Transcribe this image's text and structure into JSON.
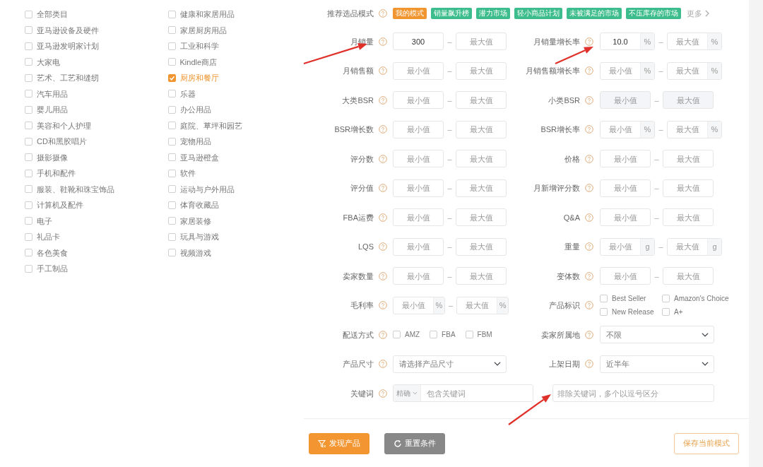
{
  "category_columns": [
    {
      "items": [
        {
          "label": "全部类目",
          "checked": false
        },
        {
          "label": "亚马逊设备及硬件",
          "checked": false
        },
        {
          "label": "亚马逊发明家计划",
          "checked": false
        },
        {
          "label": "大家电",
          "checked": false
        },
        {
          "label": "艺术、工艺和缝纫",
          "checked": false
        },
        {
          "label": "汽车用品",
          "checked": false
        },
        {
          "label": "婴儿用品",
          "checked": false
        },
        {
          "label": "美容和个人护理",
          "checked": false
        },
        {
          "label": "CD和黑胶唱片",
          "checked": false
        },
        {
          "label": "摄影摄像",
          "checked": false
        },
        {
          "label": "手机和配件",
          "checked": false
        },
        {
          "label": "服装、鞋靴和珠宝饰品",
          "checked": false
        },
        {
          "label": "计算机及配件",
          "checked": false
        },
        {
          "label": "电子",
          "checked": false
        },
        {
          "label": "礼品卡",
          "checked": false
        },
        {
          "label": "各色美食",
          "checked": false
        },
        {
          "label": "手工制品",
          "checked": false
        }
      ]
    },
    {
      "items": [
        {
          "label": "健康和家居用品",
          "checked": false
        },
        {
          "label": "家居厨房用品",
          "checked": false
        },
        {
          "label": "工业和科学",
          "checked": false
        },
        {
          "label": "Kindle商店",
          "checked": false
        },
        {
          "label": "厨房和餐厅",
          "checked": true
        },
        {
          "label": "乐器",
          "checked": false
        },
        {
          "label": "办公用品",
          "checked": false
        },
        {
          "label": "庭院、草坪和园艺",
          "checked": false
        },
        {
          "label": "宠物用品",
          "checked": false
        },
        {
          "label": "亚马逊橙盒",
          "checked": false
        },
        {
          "label": "软件",
          "checked": false
        },
        {
          "label": "运动与户外用品",
          "checked": false
        },
        {
          "label": "体育收藏品",
          "checked": false
        },
        {
          "label": "家居装修",
          "checked": false
        },
        {
          "label": "玩具与游戏",
          "checked": false
        },
        {
          "label": "视频游戏",
          "checked": false
        }
      ]
    }
  ],
  "mode": {
    "label": "推荐选品模式",
    "tags": [
      {
        "label": "我的模式",
        "selected": true
      },
      {
        "label": "销量飙升榜",
        "selected": false
      },
      {
        "label": "潜力市场",
        "selected": false
      },
      {
        "label": "轻小商品计划",
        "selected": false
      },
      {
        "label": "未被满足的市场",
        "selected": false
      },
      {
        "label": "不压库存的市场",
        "selected": false
      }
    ],
    "more": "更多"
  },
  "filter_rows": [
    [
      {
        "label": "月销量",
        "kind": "range",
        "disabled": false,
        "min": {
          "value": "300"
        },
        "separator": "–",
        "max": {
          "placeholder": "最大值"
        }
      },
      {
        "label": "月销量增长率",
        "kind": "range",
        "disabled": false,
        "min": {
          "value": "10.0",
          "unit": "%"
        },
        "separator": "–",
        "max": {
          "placeholder": "最大值",
          "unit": "%"
        }
      }
    ],
    [
      {
        "label": "月销售额",
        "kind": "range",
        "disabled": false,
        "min": {
          "placeholder": "最小值"
        },
        "separator": "–",
        "max": {
          "placeholder": "最大值"
        }
      },
      {
        "label": "月销售额增长率",
        "kind": "range",
        "disabled": false,
        "min": {
          "placeholder": "最小值",
          "unit": "%"
        },
        "separator": "–",
        "max": {
          "placeholder": "最大值",
          "unit": "%"
        }
      }
    ],
    [
      {
        "label": "大类BSR",
        "kind": "range",
        "disabled": false,
        "min": {
          "placeholder": "最小值"
        },
        "separator": "–",
        "max": {
          "placeholder": "最大值"
        }
      },
      {
        "label": "小类BSR",
        "kind": "range",
        "disabled": true,
        "min": {
          "placeholder": "最小值"
        },
        "separator": "–",
        "max": {
          "placeholder": "最大值"
        }
      }
    ],
    [
      {
        "label": "BSR增长数",
        "kind": "range",
        "disabled": false,
        "min": {
          "placeholder": "最小值"
        },
        "separator": "–",
        "max": {
          "placeholder": "最大值"
        }
      },
      {
        "label": "BSR增长率",
        "kind": "range",
        "disabled": false,
        "min": {
          "placeholder": "最小值",
          "unit": "%"
        },
        "separator": "–",
        "max": {
          "placeholder": "最大值",
          "unit": "%"
        }
      }
    ],
    [
      {
        "label": "评分数",
        "kind": "range",
        "disabled": false,
        "min": {
          "placeholder": "最小值"
        },
        "separator": "–",
        "max": {
          "placeholder": "最大值"
        }
      },
      {
        "label": "价格",
        "kind": "range",
        "disabled": false,
        "min": {
          "placeholder": "最小值"
        },
        "separator": "–",
        "max": {
          "placeholder": "最大值"
        }
      }
    ],
    [
      {
        "label": "评分值",
        "kind": "range",
        "disabled": false,
        "min": {
          "placeholder": "最小值"
        },
        "separator": "–",
        "max": {
          "placeholder": "最大值"
        }
      },
      {
        "label": "月新增评分数",
        "kind": "range",
        "disabled": false,
        "min": {
          "placeholder": "最小值"
        },
        "separator": "–",
        "max": {
          "placeholder": "最大值"
        }
      }
    ],
    [
      {
        "label": "FBA运费",
        "kind": "range",
        "disabled": false,
        "min": {
          "placeholder": "最小值"
        },
        "separator": "–",
        "max": {
          "placeholder": "最大值"
        }
      },
      {
        "label": "Q&A",
        "kind": "range",
        "disabled": false,
        "min": {
          "placeholder": "最小值"
        },
        "separator": "–",
        "max": {
          "placeholder": "最大值"
        }
      }
    ],
    [
      {
        "label": "LQS",
        "kind": "range",
        "disabled": false,
        "min": {
          "placeholder": "最小值"
        },
        "separator": "–",
        "max": {
          "placeholder": "最大值"
        }
      },
      {
        "label": "重量",
        "kind": "range",
        "disabled": false,
        "min": {
          "placeholder": "最小值",
          "unit": "g"
        },
        "separator": "–",
        "max": {
          "placeholder": "最大值",
          "unit": "g"
        }
      }
    ],
    [
      {
        "label": "卖家数量",
        "kind": "range",
        "disabled": false,
        "min": {
          "placeholder": "最小值"
        },
        "separator": "–",
        "max": {
          "placeholder": "最大值"
        }
      },
      {
        "label": "变体数",
        "kind": "range",
        "disabled": false,
        "min": {
          "placeholder": "最小值"
        },
        "separator": "–",
        "max": {
          "placeholder": "最大值"
        }
      }
    ],
    [
      {
        "label": "毛利率",
        "kind": "range",
        "disabled": false,
        "min": {
          "placeholder": "最小值",
          "unit": "%"
        },
        "separator": "–",
        "max": {
          "placeholder": "最大值",
          "unit": "%"
        }
      },
      {
        "label": "产品标识",
        "kind": "checks",
        "options": [
          {
            "label": "Best Seller",
            "checked": false
          },
          {
            "label": "Amazon's Choice",
            "checked": false
          },
          {
            "label": "New Release",
            "checked": false
          },
          {
            "label": "A+",
            "checked": false
          }
        ]
      }
    ],
    [
      {
        "label": "配送方式",
        "kind": "checks",
        "options": [
          {
            "label": "AMZ",
            "checked": false
          },
          {
            "label": "FBA",
            "checked": false
          },
          {
            "label": "FBM",
            "checked": false
          }
        ]
      },
      {
        "label": "卖家所属地",
        "kind": "select",
        "value": "不限"
      }
    ],
    [
      {
        "label": "产品尺寸",
        "kind": "select",
        "value": "请选择产品尺寸"
      },
      {
        "label": "上架日期",
        "kind": "select",
        "value": "近半年"
      }
    ],
    [
      {
        "label": "关键词",
        "kind": "keyword",
        "match": "精确",
        "placeholder": "包含关键词"
      },
      {
        "kind": "text",
        "placeholder": "排除关键词，多个以逗号区分"
      }
    ]
  ],
  "buttons": [
    {
      "label": "发现产品",
      "kind": "primary"
    },
    {
      "label": "重置条件",
      "kind": "reset"
    },
    {
      "label": "保存当前模式",
      "kind": "outline"
    }
  ]
}
